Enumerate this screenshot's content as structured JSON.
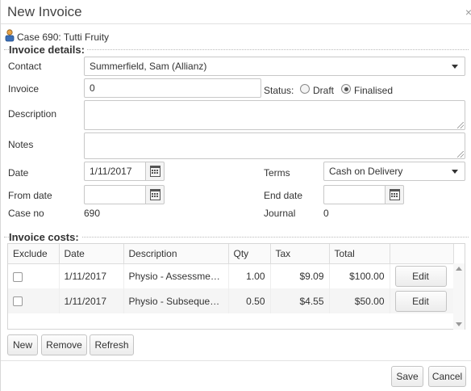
{
  "dialog": {
    "title": "New Invoice",
    "close_glyph": "×"
  },
  "case": {
    "text": "Case 690: Tutti Fruity"
  },
  "details": {
    "legend": "Invoice details:",
    "contact_label": "Contact",
    "contact_value": "Summerfield, Sam (Allianz)",
    "invoice_label": "Invoice",
    "invoice_value": "0",
    "status_label": "Status:",
    "status_options": [
      "Draft",
      "Finalised"
    ],
    "status_selected": "Finalised",
    "description_label": "Description",
    "description_value": "",
    "notes_label": "Notes",
    "notes_value": "",
    "date_label": "Date",
    "date_value": "1/11/2017",
    "terms_label": "Terms",
    "terms_value": "Cash on Delivery",
    "from_date_label": "From date",
    "from_date_value": "",
    "end_date_label": "End date",
    "end_date_value": "",
    "case_no_label": "Case no",
    "case_no_value": "690",
    "journal_label": "Journal",
    "journal_value": "0"
  },
  "costs": {
    "legend": "Invoice costs:",
    "columns": [
      "Exclude",
      "Date",
      "Description",
      "Qty",
      "Tax",
      "Total",
      ""
    ],
    "rows": [
      {
        "exclude": false,
        "date": "1/11/2017",
        "description": "Physio - Assessment Consultation",
        "qty": "1.00",
        "tax": "$9.09",
        "total": "$100.00",
        "action": "Edit"
      },
      {
        "exclude": false,
        "date": "1/11/2017",
        "description": "Physio - Subsequent Consultation",
        "qty": "0.50",
        "tax": "$4.55",
        "total": "$50.00",
        "action": "Edit"
      }
    ],
    "buttons": {
      "new": "New",
      "remove": "Remove",
      "refresh": "Refresh"
    }
  },
  "footer": {
    "save": "Save",
    "cancel": "Cancel"
  },
  "icons": {
    "person": "person-icon",
    "calendar": "calendar-icon",
    "caret": "chevron-down-icon"
  }
}
